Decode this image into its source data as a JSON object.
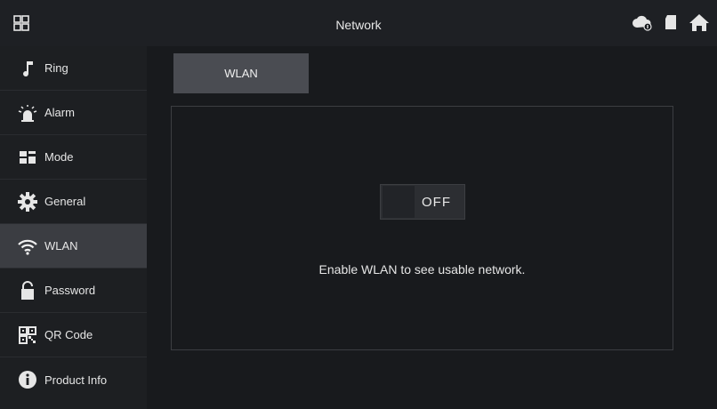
{
  "header": {
    "title": "Network"
  },
  "sidebar": {
    "items": [
      {
        "label": "Ring",
        "icon": "music-note-icon",
        "active": false
      },
      {
        "label": "Alarm",
        "icon": "alarm-light-icon",
        "active": false
      },
      {
        "label": "Mode",
        "icon": "mode-grid-icon",
        "active": false
      },
      {
        "label": "General",
        "icon": "gear-icon",
        "active": false
      },
      {
        "label": "WLAN",
        "icon": "wifi-icon",
        "active": true
      },
      {
        "label": "Password",
        "icon": "lock-icon",
        "active": false
      },
      {
        "label": "QR Code",
        "icon": "qr-code-icon",
        "active": false
      },
      {
        "label": "Product Info",
        "icon": "info-icon",
        "active": false
      }
    ]
  },
  "main": {
    "tabs": [
      {
        "label": "WLAN",
        "active": true
      }
    ],
    "wlan_toggle": {
      "state_label": "OFF",
      "enabled": false
    },
    "hint": "Enable WLAN to see usable network."
  },
  "colors": {
    "background": "#15171b",
    "sidebar": "#1d1f22",
    "active_item": "#3b3d42",
    "tab": "#4a4c52",
    "text": "#e6e6e6"
  }
}
